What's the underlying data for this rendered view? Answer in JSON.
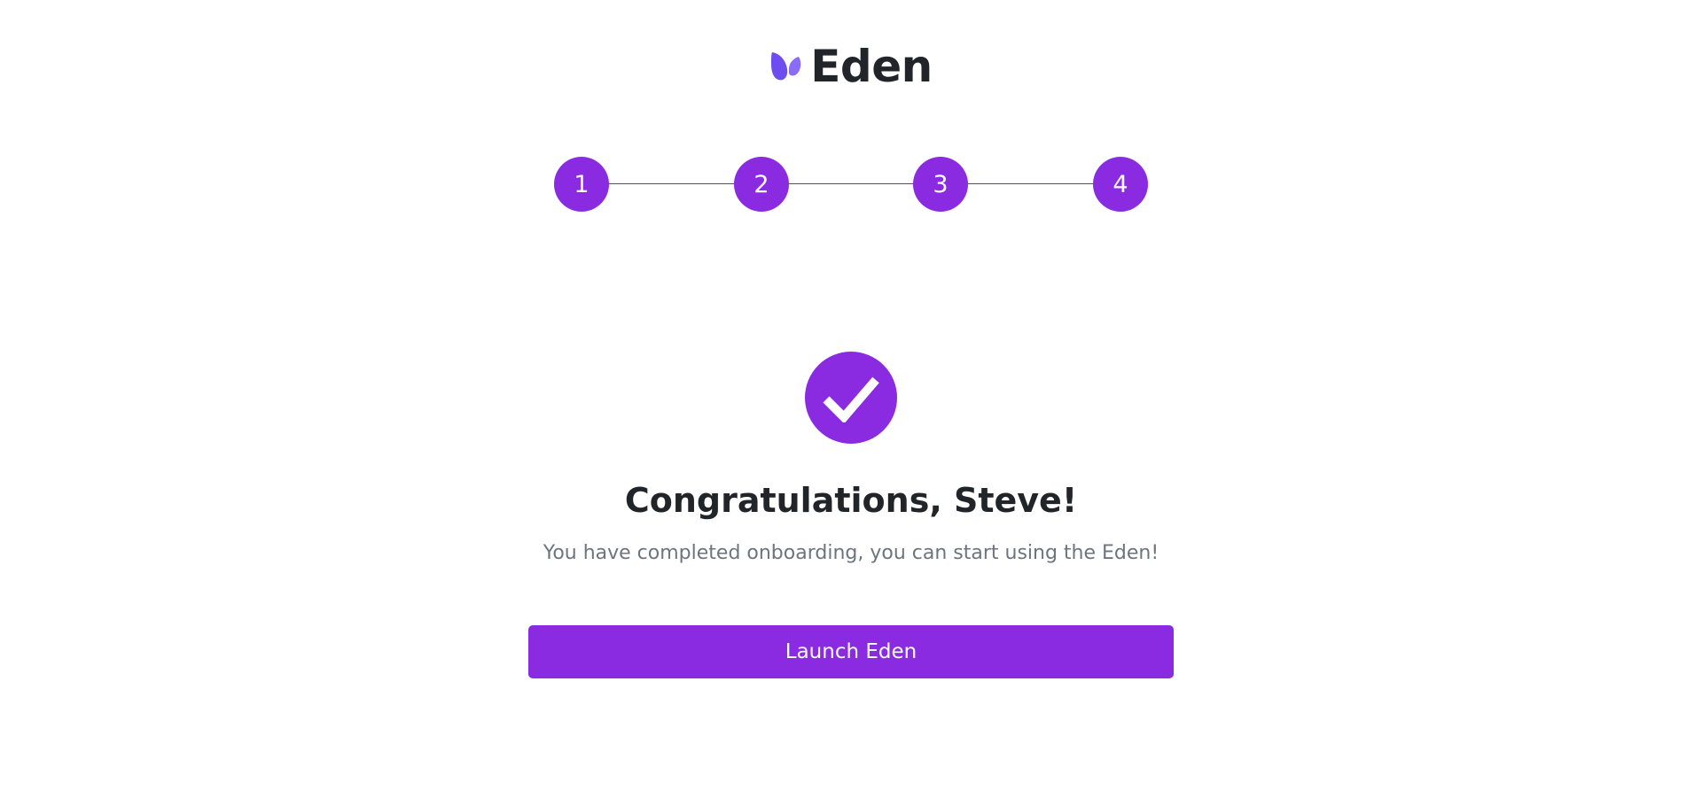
{
  "brand": {
    "name": "Eden",
    "logo_icon": "eden-leaf-logo",
    "logo_color": "#7a5af8"
  },
  "stepper": {
    "steps": [
      {
        "label": "1"
      },
      {
        "label": "2"
      },
      {
        "label": "3"
      },
      {
        "label": "4"
      }
    ],
    "completed_steps": 4,
    "accent_color": "#8a2be2"
  },
  "completion": {
    "icon": "check-circle-icon",
    "title": "Congratulations, Steve!",
    "message": "You have completed onboarding, you can start using the Eden!"
  },
  "actions": {
    "launch_label": "Launch Eden"
  },
  "colors": {
    "primary": "#8a2be2",
    "text": "#212529",
    "muted": "#6c757d",
    "background": "#ffffff"
  }
}
